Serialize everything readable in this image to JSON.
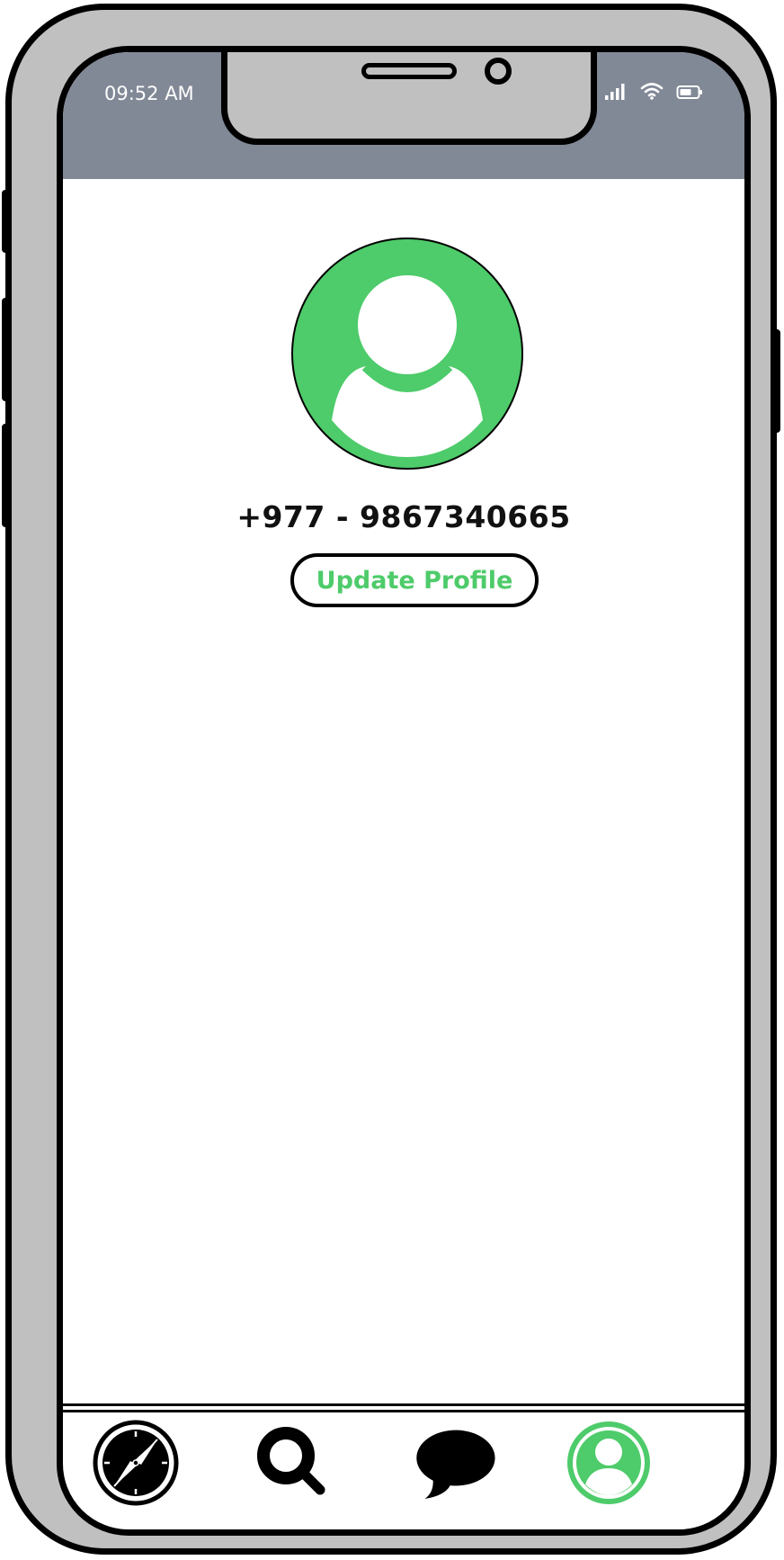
{
  "status_bar": {
    "time": "09:52 AM",
    "icons": [
      "signal-icon",
      "wifi-icon",
      "battery-icon"
    ]
  },
  "profile": {
    "avatar_icon": "user-avatar-icon",
    "phone_number": "+977 - 9867340665",
    "update_button_label": "Update Profile"
  },
  "tab_bar": {
    "tabs": [
      {
        "icon": "compass-icon",
        "active": false
      },
      {
        "icon": "search-icon",
        "active": false
      },
      {
        "icon": "chat-bubble-icon",
        "active": false
      },
      {
        "icon": "profile-icon",
        "active": true
      }
    ]
  },
  "colors": {
    "accent": "#4ecb6a",
    "status_bar": "#818896",
    "frame": "#c0c0c0"
  }
}
